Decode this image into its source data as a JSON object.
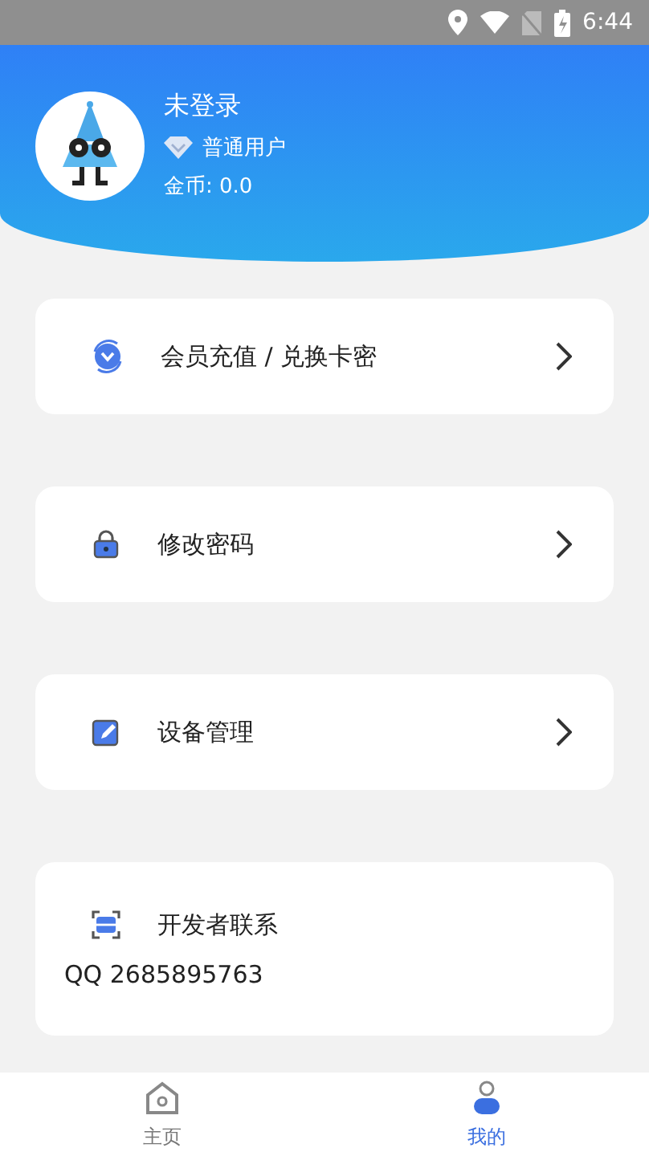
{
  "status_bar": {
    "time": "6:44"
  },
  "profile": {
    "name": "未登录",
    "level": "普通用户",
    "coins": "金币: 0.0"
  },
  "menu": [
    {
      "kind": "link",
      "label": "会员充值 / 兑换卡密"
    },
    {
      "kind": "link",
      "label": "修改密码"
    },
    {
      "kind": "link",
      "label": "设备管理"
    },
    {
      "kind": "contact",
      "label": "开发者联系",
      "detail": "QQ 2685895763"
    }
  ],
  "tabs": [
    {
      "label": "主页",
      "selected": false
    },
    {
      "label": "我的",
      "selected": true
    }
  ]
}
